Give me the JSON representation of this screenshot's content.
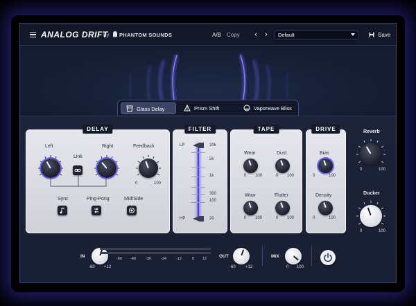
{
  "header": {
    "title": "ANALOG DRIFT",
    "by": "by",
    "brand": "PHANTOM SOUNDS",
    "ab": "A/B",
    "copy": "Copy",
    "prev": "‹",
    "next": "›",
    "preset": "Default",
    "save": "Save"
  },
  "tabs": [
    {
      "label": "Glass Delay",
      "active": true
    },
    {
      "label": "Prism Shift",
      "active": false
    },
    {
      "label": "Vaporwave Bliss",
      "active": false
    }
  ],
  "delay": {
    "title": "DELAY",
    "left": "Left",
    "right": "Right",
    "link": "Link",
    "feedback": "Feedback",
    "fb_min": "0",
    "fb_max": "100",
    "sync": "Sync",
    "pingpong": "Ping-Pong",
    "midside": "Mid/Side"
  },
  "filter": {
    "title": "FILTER",
    "lp": "LP",
    "hp": "HP",
    "scale": [
      "20k",
      "5k",
      "1k",
      "300",
      "100",
      "20"
    ]
  },
  "tape": {
    "title": "TAPE",
    "wear": "Wear",
    "dust": "Dust",
    "wow": "Wow",
    "flutter": "Flutter",
    "min": "0",
    "max": "100"
  },
  "drive": {
    "title": "DRIVE",
    "bias": "Bias",
    "density": "Density",
    "min": "0",
    "max": "100"
  },
  "side": {
    "reverb": "Reverb",
    "ducker": "Ducker",
    "min": "0",
    "max": "100"
  },
  "footer": {
    "in": "IN",
    "in_min": "-60",
    "in_max": "+12",
    "meter_ticks": [
      "-60",
      "-48",
      "-36",
      "-24",
      "-12",
      "0",
      "12"
    ],
    "out": "OUT",
    "out_min": "-60",
    "out_max": "+12",
    "mix": "MIX",
    "mix_min": "0",
    "mix_max": "100"
  },
  "colors": {
    "accent": "#6c63ff",
    "background": "#1c2336",
    "panel": "#dcdde3"
  }
}
